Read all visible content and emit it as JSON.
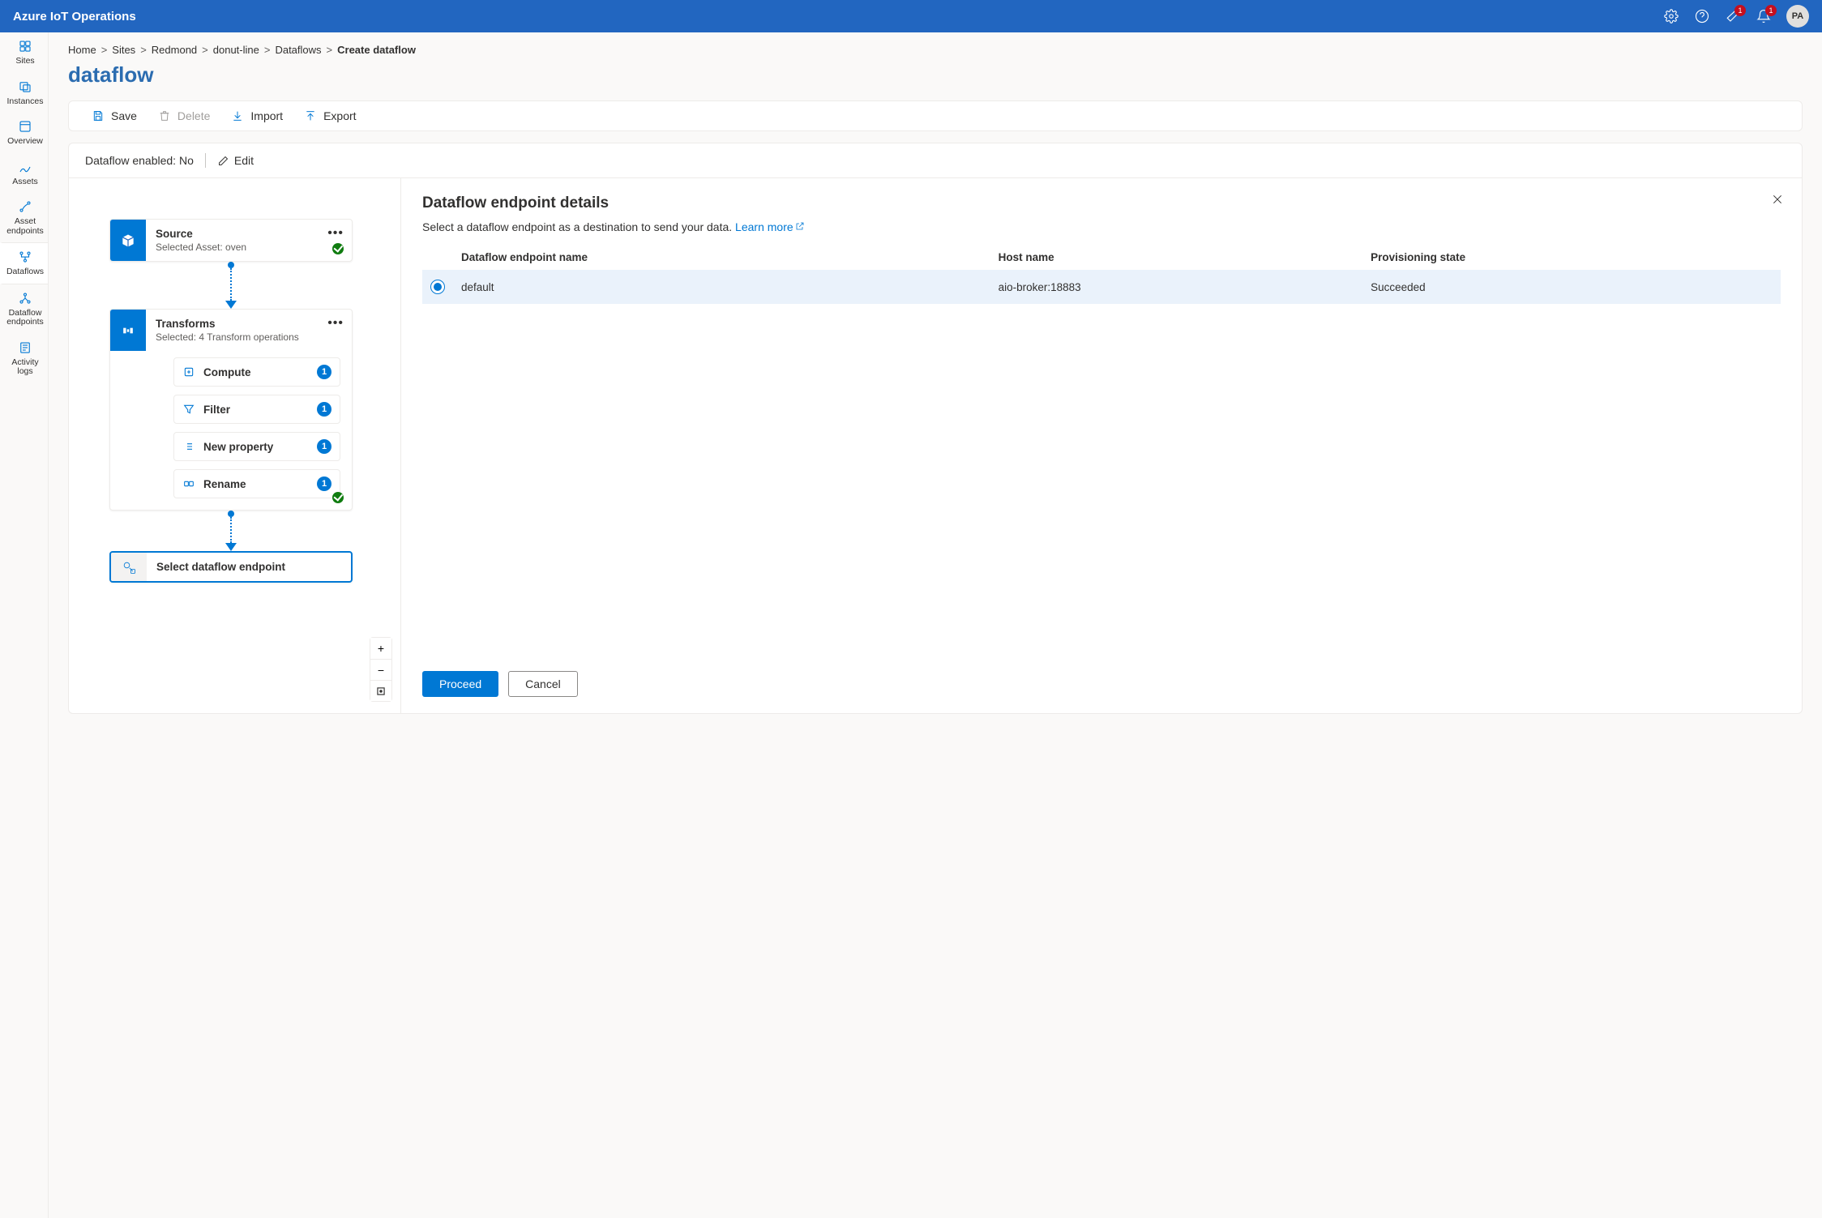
{
  "header": {
    "brand": "Azure IoT Operations",
    "alerts_badge": "1",
    "notifications_badge": "1",
    "user_initials": "PA"
  },
  "leftnav": {
    "items": [
      {
        "label": "Sites",
        "icon": "sites"
      },
      {
        "label": "Instances",
        "icon": "instances"
      },
      {
        "label": "Overview",
        "icon": "overview"
      },
      {
        "label": "Assets",
        "icon": "assets"
      },
      {
        "label": "Asset endpoints",
        "icon": "asset-endpoints"
      },
      {
        "label": "Dataflows",
        "icon": "dataflows",
        "selected": true
      },
      {
        "label": "Dataflow endpoints",
        "icon": "dataflow-endpoints"
      },
      {
        "label": "Activity logs",
        "icon": "activity-logs"
      }
    ]
  },
  "breadcrumbs": [
    {
      "label": "Home"
    },
    {
      "label": "Sites"
    },
    {
      "label": "Redmond"
    },
    {
      "label": "donut-line"
    },
    {
      "label": "Dataflows"
    },
    {
      "label": "Create dataflow",
      "current": true
    }
  ],
  "page_title": "dataflow",
  "toolbar": {
    "save": "Save",
    "delete": "Delete",
    "import": "Import",
    "export": "Export"
  },
  "status": {
    "enabled_label": "Dataflow enabled: No",
    "edit": "Edit"
  },
  "canvas": {
    "source": {
      "title": "Source",
      "sub": "Selected Asset: oven"
    },
    "transforms": {
      "title": "Transforms",
      "sub": "Selected: 4 Transform operations",
      "children": [
        {
          "label": "Compute",
          "count": "1",
          "icon": "compute"
        },
        {
          "label": "Filter",
          "count": "1",
          "icon": "filter"
        },
        {
          "label": "New property",
          "count": "1",
          "icon": "newprop"
        },
        {
          "label": "Rename",
          "count": "1",
          "icon": "rename"
        }
      ]
    },
    "destination": {
      "title": "Select dataflow endpoint"
    }
  },
  "panel": {
    "title": "Dataflow endpoint details",
    "description": "Select a dataflow endpoint as a destination to send your data. ",
    "learn_more": "Learn more",
    "columns": {
      "name": "Dataflow endpoint name",
      "host": "Host name",
      "state": "Provisioning state"
    },
    "rows": [
      {
        "name": "default",
        "host": "aio-broker:18883",
        "state": "Succeeded",
        "selected": true
      }
    ],
    "proceed": "Proceed",
    "cancel": "Cancel"
  }
}
